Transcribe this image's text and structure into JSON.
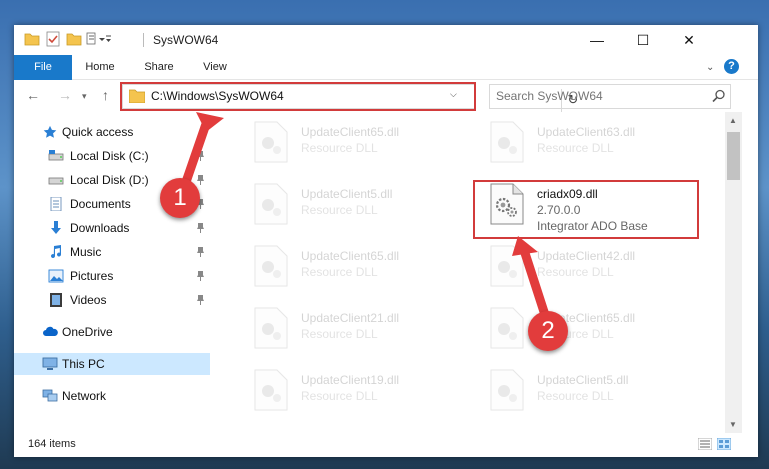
{
  "window": {
    "title": "SysWOW64",
    "controls": {
      "minimize": "—",
      "maximize": "☐",
      "close": "✕"
    }
  },
  "ribbon": {
    "tabs": [
      "File",
      "Home",
      "Share",
      "View"
    ],
    "help": "?"
  },
  "nav": {
    "back": "←",
    "forward": "→",
    "recent": "▾",
    "up": "↑",
    "address": "C:\\Windows\\SysWOW64",
    "address_dropdown": "⌵",
    "refresh": "↻",
    "search_placeholder": "Search SysWOW64"
  },
  "sidebar": {
    "items": [
      {
        "label": "Quick access",
        "icon": "star-icon"
      },
      {
        "label": "Local Disk (C:)",
        "icon": "drive-icon"
      },
      {
        "label": "Local Disk (D:)",
        "icon": "drive-icon"
      },
      {
        "label": "Documents",
        "icon": "documents-icon"
      },
      {
        "label": "Downloads",
        "icon": "download-icon"
      },
      {
        "label": "Music",
        "icon": "music-icon"
      },
      {
        "label": "Pictures",
        "icon": "pictures-icon"
      },
      {
        "label": "Videos",
        "icon": "videos-icon"
      },
      {
        "label": "OneDrive",
        "icon": "cloud-icon"
      },
      {
        "label": "This PC",
        "icon": "computer-icon"
      },
      {
        "label": "Network",
        "icon": "network-icon"
      }
    ]
  },
  "files": [
    {
      "name": "UpdateClient65.dll",
      "desc": "Resource DLL"
    },
    {
      "name": "UpdateClient63.dll",
      "desc": "Resource DLL"
    },
    {
      "name": "UpdateClient5.dll",
      "desc": "Resource DLL"
    },
    {
      "name": "criadx09.dll",
      "version": "2.70.0.0",
      "desc": "Integrator ADO Base"
    },
    {
      "name": "UpdateClient65.dll",
      "desc": "Resource DLL"
    },
    {
      "name": "UpdateClient42.dll",
      "desc": "Resource DLL"
    },
    {
      "name": "UpdateClient21.dll",
      "desc": "Resource DLL"
    },
    {
      "name": "UpdateClient65.dll",
      "desc": "Resource DLL"
    },
    {
      "name": "UpdateClient19.dll",
      "desc": "Resource DLL"
    },
    {
      "name": "UpdateClient5.dll",
      "desc": "Resource DLL"
    }
  ],
  "status": {
    "item_count": "164 items"
  },
  "annotations": {
    "step1": "1",
    "step2": "2"
  },
  "colors": {
    "accent": "#1979ca",
    "highlight": "#d23b3b",
    "selection": "#cce8ff"
  }
}
